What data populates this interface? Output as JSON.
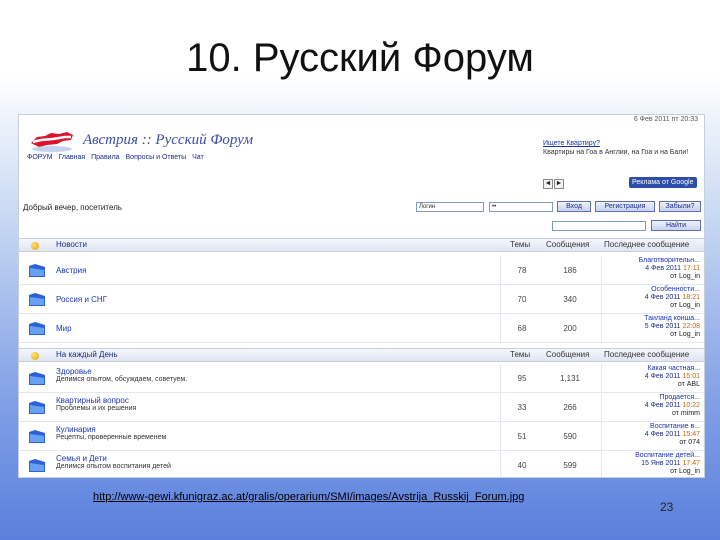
{
  "slide": {
    "title": "10. Русский Форум",
    "caption": "http://www-gewi.kfunigraz.ac.at/gralis/operarium/SMI/images/Avstrija_Russkij_Forum.jpg",
    "page_number": "23"
  },
  "forum": {
    "date": "6 Фев 2011 пт 20:33",
    "site_title": "Австрия :: Русский Форум",
    "nav": [
      "ФОРУМ",
      "Главная",
      "Правила",
      "Вопросы и Ответы",
      "Чат"
    ],
    "ad": {
      "title": "Ищете Квартиру?",
      "text": "Квартиры на Гоа в Англии, на Гоа и на Бали!",
      "prev": "◄",
      "next": "►",
      "badge": "Реклама от Google"
    },
    "welcome": "Добрый вечер, посетитель",
    "login": {
      "username_value": "Логин",
      "password_value": "••",
      "login_button": "Вход",
      "register_button": "Регистрация",
      "help_button": "Забыли?",
      "search_button": "Найти"
    },
    "categories": [
      {
        "name": "Новости",
        "col_topics": "Темы",
        "col_posts": "Сообщения",
        "col_last": "Последнее сообщение",
        "forums": [
          {
            "name": "Австрия",
            "desc": "",
            "topics": "78",
            "posts": "186",
            "last_title": "Благотворительн...",
            "last_date": "4 Фев 2011",
            "last_time": "17:11",
            "last_user": "от Log_in"
          },
          {
            "name": "Россия и СНГ",
            "desc": "",
            "topics": "70",
            "posts": "340",
            "last_title": "Особенности...",
            "last_date": "4 Фев 2011",
            "last_time": "18:21",
            "last_user": "от Log_in"
          },
          {
            "name": "Мир",
            "desc": "",
            "topics": "68",
            "posts": "200",
            "last_title": "Таиланд конша...",
            "last_date": "5 Фев 2011",
            "last_time": "22:08",
            "last_user": "от Log_in"
          }
        ]
      },
      {
        "name": "На каждый День",
        "col_topics": "Темы",
        "col_posts": "Сообщения",
        "col_last": "Последнее сообщение",
        "forums": [
          {
            "name": "Здоровье",
            "desc": "Делимся опытом, обсуждаем, советуем.",
            "topics": "95",
            "posts": "1,131",
            "last_title": "Какая частная...",
            "last_date": "4 Фев 2011",
            "last_time": "15:01",
            "last_user": "от ABL"
          },
          {
            "name": "Квартирный вопрос",
            "desc": "Проблемы и их решения",
            "topics": "33",
            "posts": "266",
            "last_title": "Продается...",
            "last_date": "4 Фев 2011",
            "last_time": "10:22",
            "last_user": "от mimm"
          },
          {
            "name": "Кулинария",
            "desc": "Рецепты, проверенные временем",
            "topics": "51",
            "posts": "590",
            "last_title": "Воспитание в...",
            "last_date": "4 Фев 2011",
            "last_time": "15:47",
            "last_user": "от 074"
          },
          {
            "name": "Семья и Дети",
            "desc": "Делимся опытом воспитания детей",
            "topics": "40",
            "posts": "599",
            "last_title": "Воспитание детей...",
            "last_date": "15 Янв 2011",
            "last_time": "17:47",
            "last_user": "от Log_in"
          }
        ]
      }
    ]
  }
}
